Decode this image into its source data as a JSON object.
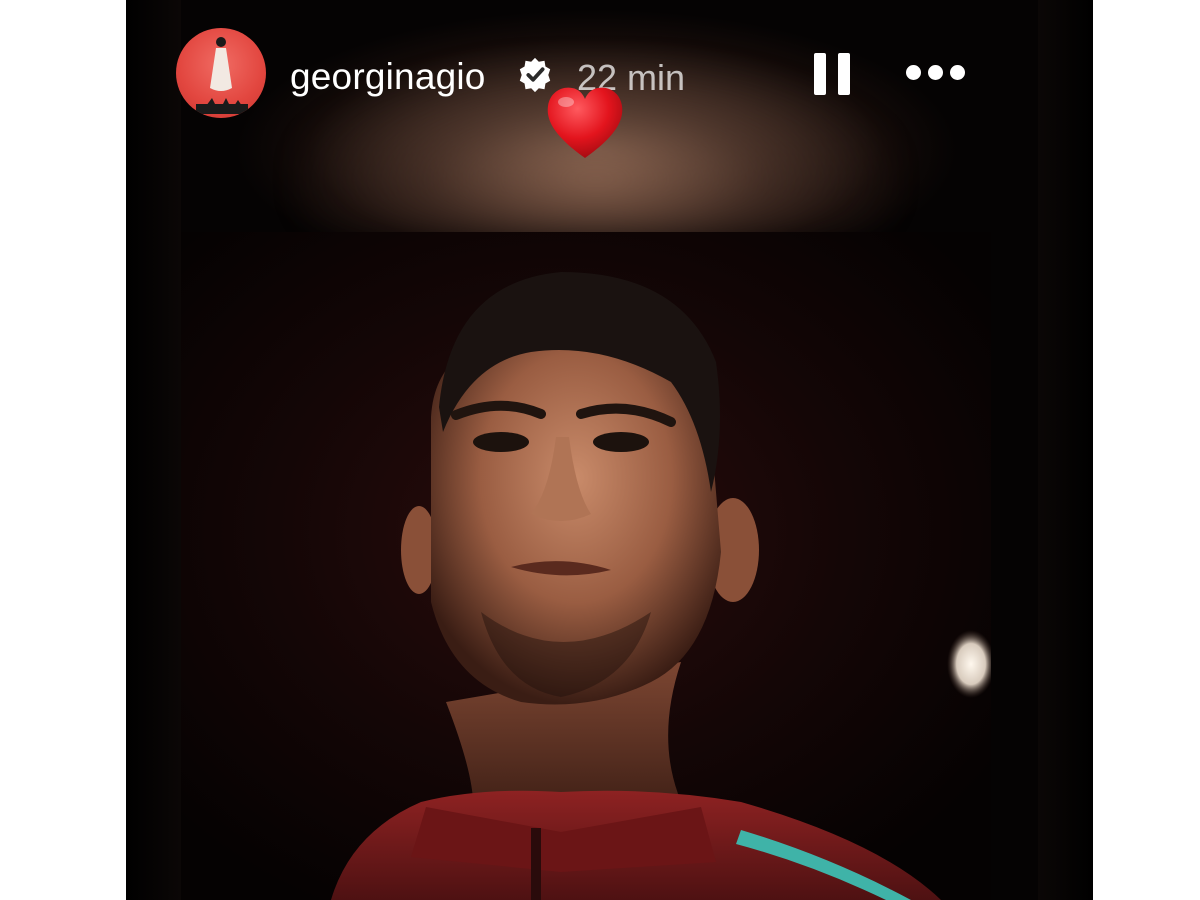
{
  "story": {
    "username": "georginagio",
    "timestamp": "22 min",
    "verified": true,
    "sticker": "heart-emoji"
  },
  "controls": {
    "pause_icon": "pause-icon",
    "more_icon": "more-options-icon"
  },
  "colors": {
    "avatar_bg": "#e2463f",
    "heart": "#e3141d",
    "jacket": "#7a1a1c",
    "jacket_trim": "#3fb3a8"
  }
}
